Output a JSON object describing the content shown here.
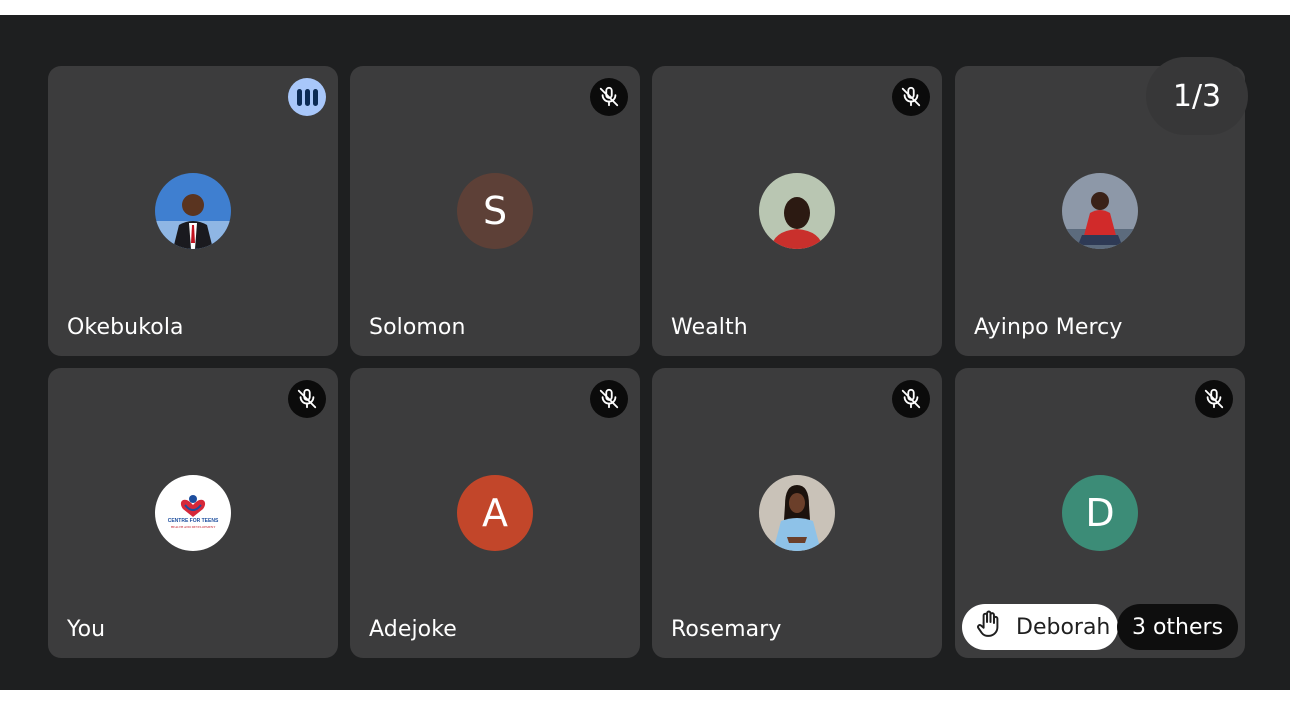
{
  "pager": {
    "label": "1/3"
  },
  "participants": [
    {
      "name": "Okebukola",
      "status": "speaking",
      "avatar_type": "photo"
    },
    {
      "name": "Solomon",
      "status": "muted",
      "avatar_type": "initial",
      "initial": "S",
      "color": "#5d4037"
    },
    {
      "name": "Wealth",
      "status": "muted",
      "avatar_type": "photo"
    },
    {
      "name": "Ayinpo Mercy",
      "status": "none",
      "avatar_type": "photo"
    },
    {
      "name": "You",
      "status": "muted",
      "avatar_type": "logo",
      "logo_text": "CENTRE FOR TEENS",
      "logo_subtext": "HEALTH AND DEVELOPMENT"
    },
    {
      "name": "Adejoke",
      "status": "muted",
      "avatar_type": "initial",
      "initial": "A",
      "color": "#c2462a"
    },
    {
      "name": "Rosemary",
      "status": "muted",
      "avatar_type": "photo"
    },
    {
      "name": "Deborah",
      "status": "muted",
      "avatar_type": "initial",
      "initial": "D",
      "color": "#3c8c77"
    }
  ],
  "raised_hand": {
    "name": "Deborah",
    "icon": "raised-hand-icon"
  },
  "overflow": {
    "label": "3 others"
  },
  "colors": {
    "stage": "#1e1f20",
    "tile": "#3c3c3d",
    "speaking_badge": "#a8c7fa"
  }
}
